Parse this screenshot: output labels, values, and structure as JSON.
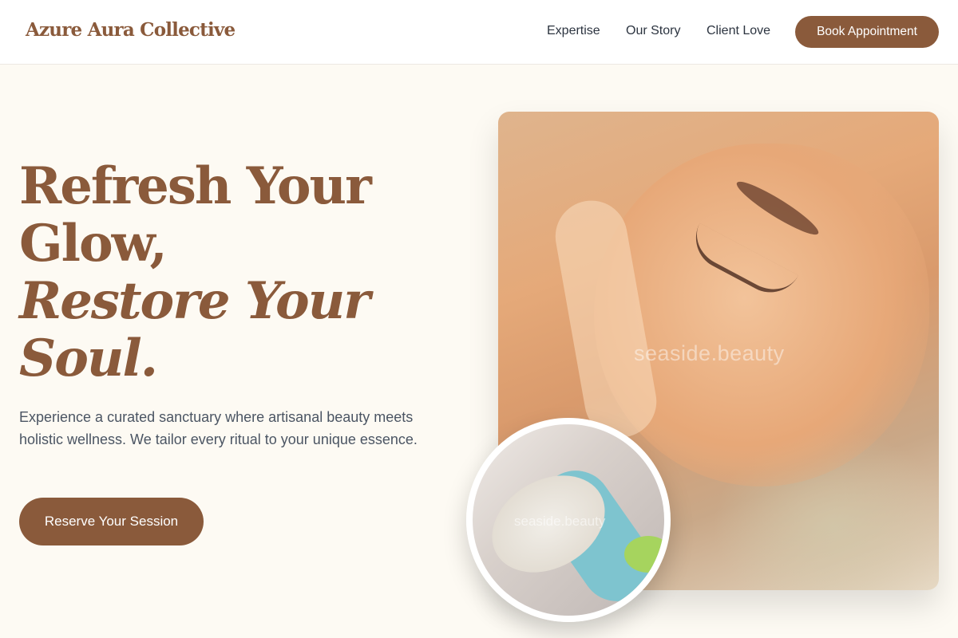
{
  "brand": "Azure Aura Collective",
  "nav": {
    "links": [
      "Expertise",
      "Our Story",
      "Client Love"
    ],
    "cta": "Book Appointment"
  },
  "hero": {
    "headline_line1": "Refresh Your",
    "headline_line2": "Glow,",
    "headline_line3": "Restore Your",
    "headline_line4": "Soul.",
    "lede": "Experience a curated sanctuary where artisanal beauty meets holistic wellness. We tailor every ritual to your unique essence.",
    "cta": "Reserve Your Session",
    "image_watermark": "seaside.beauty",
    "circle_watermark": "seaside.beauty"
  },
  "colors": {
    "accent": "#8a5a3b",
    "background": "#fdfaf3",
    "body_text": "#4b5563"
  }
}
